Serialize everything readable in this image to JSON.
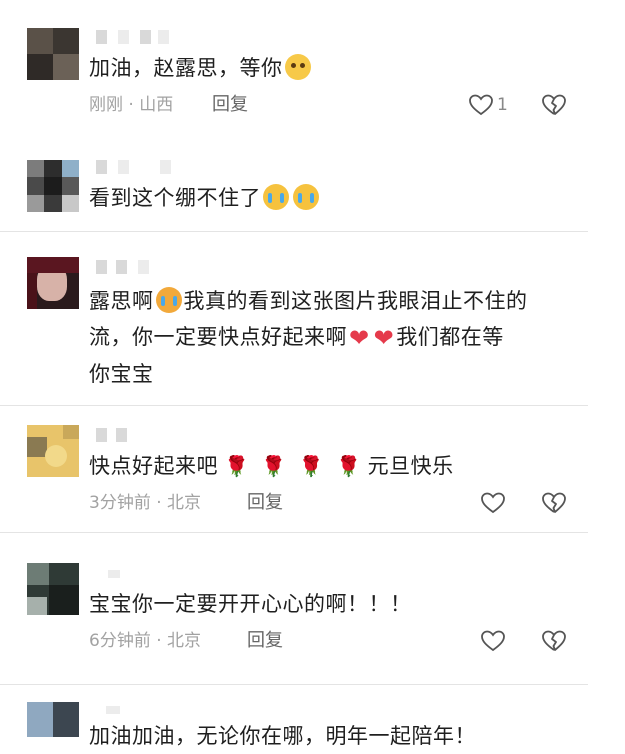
{
  "comments": [
    {
      "text_parts": [
        "加油，赵露思，等你"
      ],
      "emojis": [
        "pleading-face"
      ],
      "time": "刚刚",
      "location": "山西",
      "reply_label": "回复",
      "like_count": "1"
    },
    {
      "text_parts": [
        "看到这个绷不住了"
      ],
      "emojis": [
        "crying-face",
        "crying-face"
      ]
    },
    {
      "text_parts": [
        "露思啊",
        "我真的看到这张图片我眼泪止不住的",
        "流，你一定要快点好起来啊",
        "我们都在等",
        "你宝宝"
      ],
      "emojis": [
        "loudly-crying-face",
        "red-heart",
        "red-heart"
      ]
    },
    {
      "text_parts": [
        "快点好起来吧",
        "元旦快乐"
      ],
      "emojis": [
        "rose",
        "rose",
        "rose",
        "rose"
      ],
      "time": "3分钟前",
      "location": "北京",
      "reply_label": "回复"
    },
    {
      "text_parts": [
        "宝宝你一定要开开心心的啊！！！"
      ],
      "time": "6分钟前",
      "location": "北京",
      "reply_label": "回复"
    },
    {
      "text_parts": [
        "加油加油，无论你在哪，明年一起陪年！"
      ]
    }
  ],
  "meta_separator": "·",
  "colors": {
    "heart": "#e53a4b",
    "meta_text": "#a2a2a2",
    "divider": "#e4e4e4"
  }
}
